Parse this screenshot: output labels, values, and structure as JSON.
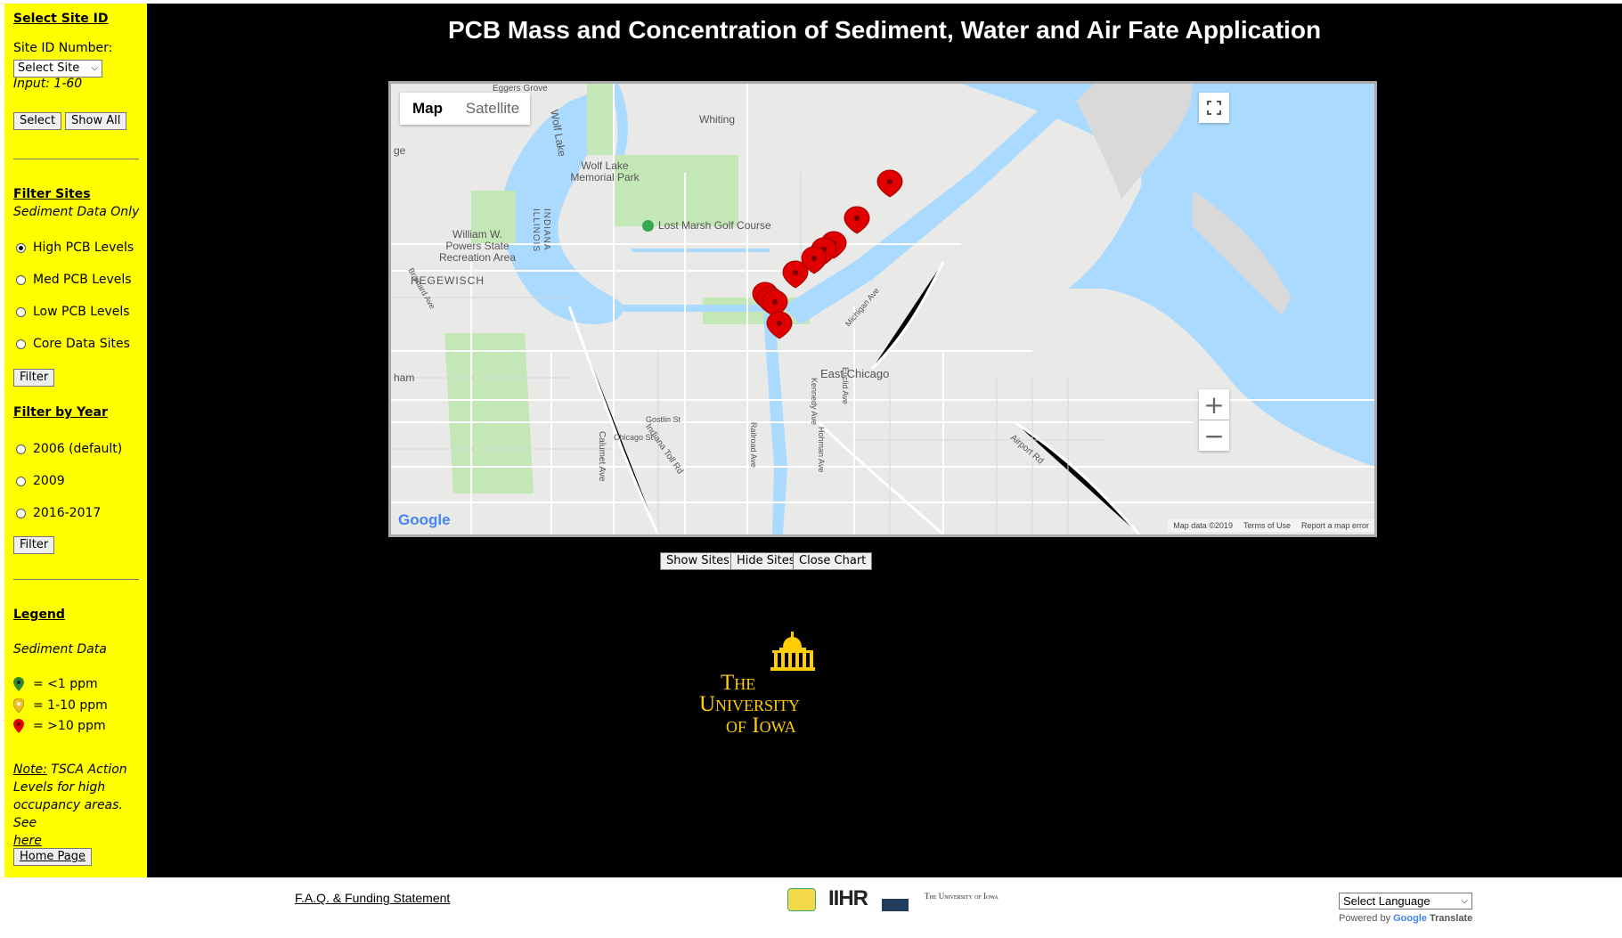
{
  "sidebar": {
    "select_site_heading": "Select Site ID",
    "site_id_label": "Site ID Number:",
    "site_select_value": "Select Site",
    "input_hint": "Input: 1-60",
    "select_button": "Select",
    "show_all_button": "Show All",
    "filter_sites_heading": "Filter Sites",
    "filter_sites_sub": "Sediment Data Only",
    "filter_options": [
      {
        "label": "High PCB Levels",
        "checked": true
      },
      {
        "label": "Med PCB Levels",
        "checked": false
      },
      {
        "label": "Low PCB Levels",
        "checked": false
      },
      {
        "label": "Core Data Sites",
        "checked": false
      }
    ],
    "filter_button": "Filter",
    "filter_year_heading": "Filter by Year",
    "year_options": [
      {
        "label": "2006 (default)",
        "checked": false
      },
      {
        "label": "2009",
        "checked": false
      },
      {
        "label": "2016-2017",
        "checked": false
      }
    ],
    "filter_year_button": "Filter",
    "legend_heading": "Legend",
    "legend_sub": "Sediment Data",
    "legend_items": [
      {
        "label": "= <1 ppm",
        "color": "#2e8b2e"
      },
      {
        "label": "= 1-10 ppm",
        "color": "#f0c020"
      },
      {
        "label": "= >10 ppm",
        "color": "#e00000"
      }
    ],
    "note_label": "Note:",
    "note_text_1": " TSCA Action",
    "note_text_2": "Levels for high",
    "note_text_3": "occupancy areas. See",
    "note_link": "here",
    "home_button": "Home Page"
  },
  "main": {
    "title": "PCB Mass and Concentration of Sediment, Water and Air Fate Application",
    "map": {
      "map_tab": "Map",
      "satellite_tab": "Satellite",
      "zoom_in": "+",
      "zoom_out": "−",
      "attribution": "Map data ©2019",
      "terms": "Terms of Use",
      "report": "Report a map error",
      "google": "Google",
      "labels": {
        "whiting": "Whiting",
        "wolf_lake": "Wolf Lake Memorial Park",
        "wolf_lake_water": "Wolf Lake",
        "lost_marsh": "Lost Marsh Golf Course",
        "powers": "William W. Powers State Recreation Area",
        "hegewisch": "HEGEWISCH",
        "east_chicago": "East Chicago",
        "gostlin": "Gostlin St",
        "chicago_st": "Chicago St",
        "toll_rd": "Indiana Toll Rd",
        "calumet": "Calumet Ave",
        "kennedy": "Kennedy Ave",
        "michigan": "Michigan Ave",
        "airport": "Airport Rd",
        "ham": "ham",
        "illinois": "ILLINOIS",
        "indiana": "INDIANA",
        "brainard": "Brainard Ave",
        "euclid": "Euclid Ave",
        "railroad": "Railroad Ave",
        "hohman": "Hohman Ave",
        "ge": "ge",
        "eggers": "Eggers Grove"
      },
      "markers_color": "#e00000",
      "marker_count": 11
    },
    "buttons": {
      "show_sites": "Show Sites",
      "hide_sites": "Hide Sites",
      "close_chart": "Close Chart"
    },
    "logo": {
      "line1": "The",
      "line2": "University",
      "line3": "of Iowa",
      "color": "#ffcd00"
    }
  },
  "footer": {
    "faq_link": "F.A.Q. & Funding Statement",
    "ihr_logo": "IIHR",
    "ui_logo_text": "The University of Iowa",
    "language_select": "Select Language",
    "powered_by": "Powered by",
    "google": "Google",
    "translate": "Translate"
  }
}
